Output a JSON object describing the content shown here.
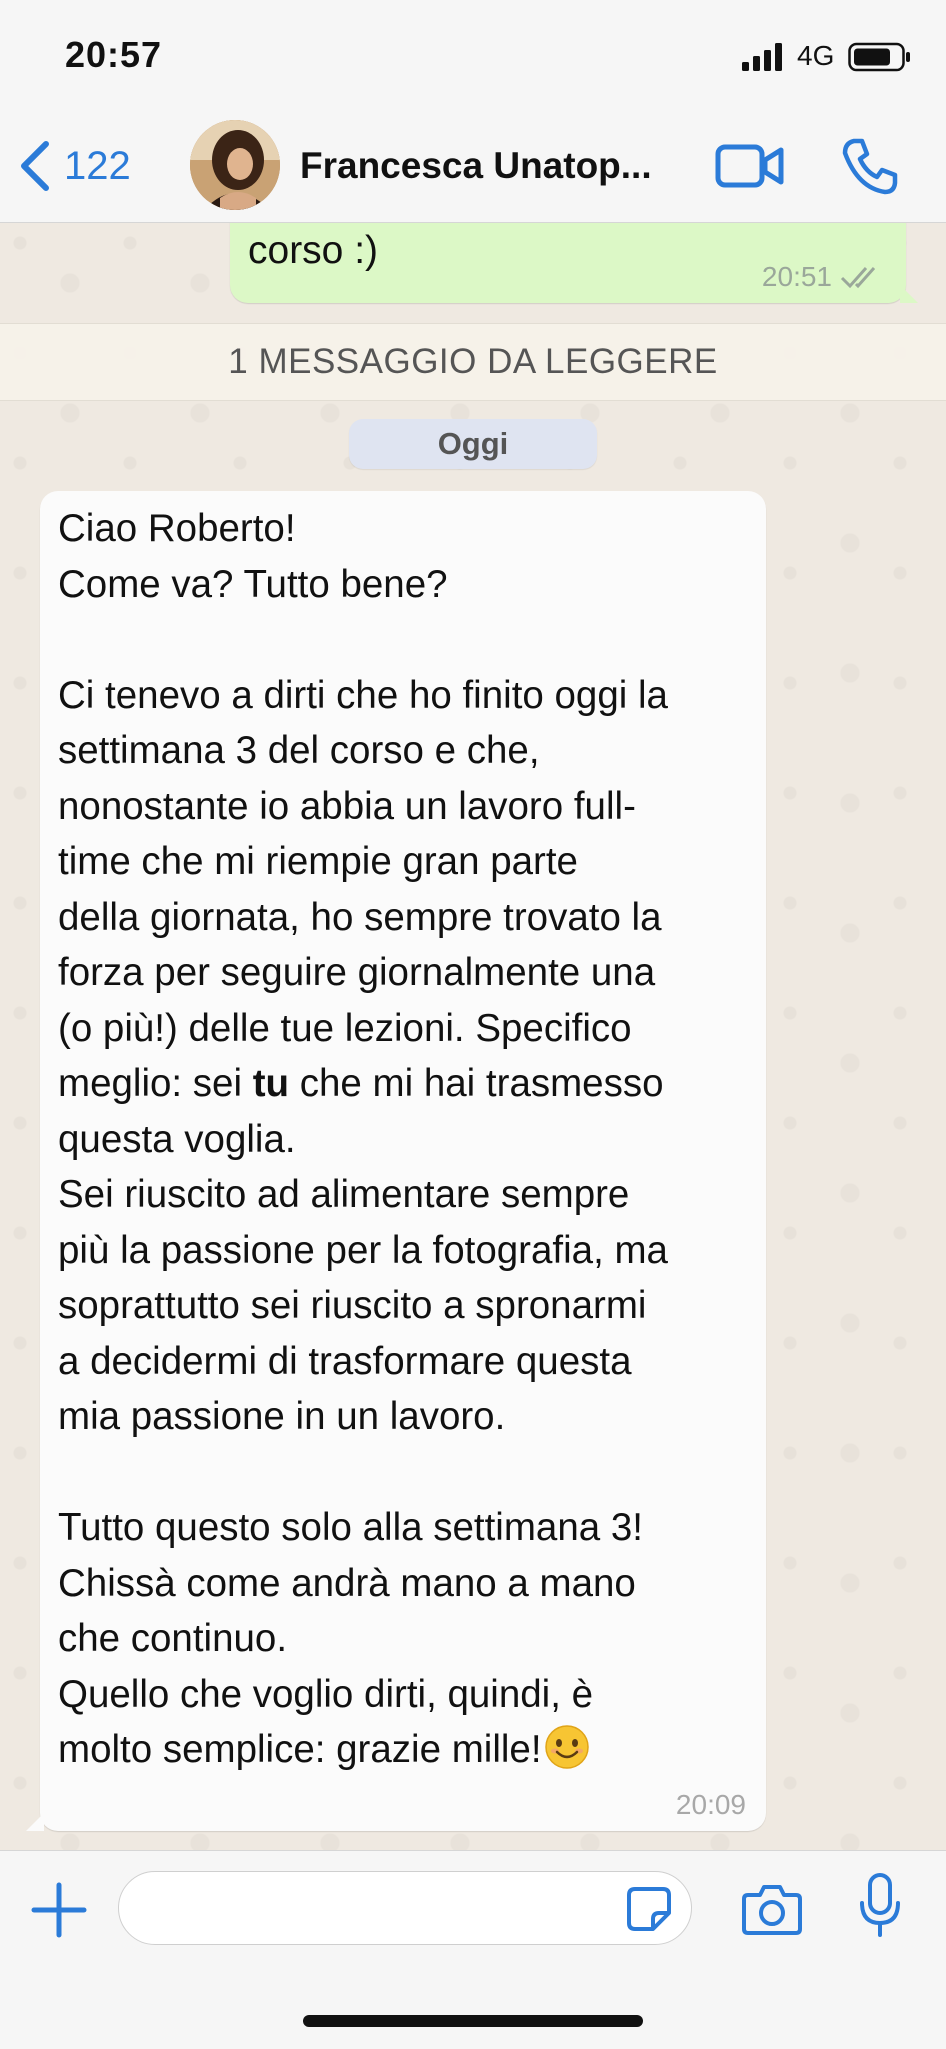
{
  "status_bar": {
    "time": "20:57",
    "network": "4G",
    "icons": [
      "signal-icon",
      "battery-icon"
    ]
  },
  "header": {
    "back_count": "122",
    "contact_name": "Francesca Unatop...",
    "icons": [
      "chevron-left-icon",
      "video-camera-icon",
      "phone-icon"
    ]
  },
  "chat": {
    "previous_message": {
      "text": "corso :)",
      "time": "20:51",
      "status_icon": "double-check-icon"
    },
    "unread_banner": "1 MESSAGGIO DA LEGGERE",
    "date_separator": "Oggi",
    "incoming_message": {
      "lines": [
        "Ciao Roberto!",
        "Come va? Tutto bene?",
        "",
        "Ci tenevo a dirti che ho finito oggi la",
        "settimana 3 del corso e che,",
        "nonostante io abbia un lavoro full-",
        "time che mi riempie gran parte",
        "della giornata, ho sempre trovato la",
        "forza per seguire giornalmente una",
        "(o più!) delle tue lezioni. Specifico",
        "meglio: sei tu che mi hai trasmesso",
        "questa voglia.",
        "Sei riuscito ad alimentare sempre",
        "più la passione per la fotografia, ma",
        "soprattutto sei riuscito a spronarmi",
        "a decidermi di trasformare questa",
        "mia passione in un lavoro.",
        "",
        "Tutto questo solo alla settimana 3!",
        "Chissà come andrà mano a mano",
        "che continuo.",
        "Quello che voglio dirti, quindi, è",
        "molto semplice: grazie mille!"
      ],
      "bold_segment": {
        "before": "meglio: sei ",
        "bold": "tu",
        "after": " che mi hai trasmesso"
      },
      "trailing_emoji": "smiling-face-emoji",
      "time": "20:09"
    }
  },
  "input_bar": {
    "placeholder": "",
    "icons": [
      "plus-icon",
      "sticker-icon",
      "camera-icon",
      "microphone-icon"
    ]
  },
  "colors": {
    "accent": "#2b7bd8",
    "outgoing_bubble": "#dcf8c6",
    "incoming_bubble": "#fbfbfb",
    "chat_background": "#efe9e1"
  }
}
